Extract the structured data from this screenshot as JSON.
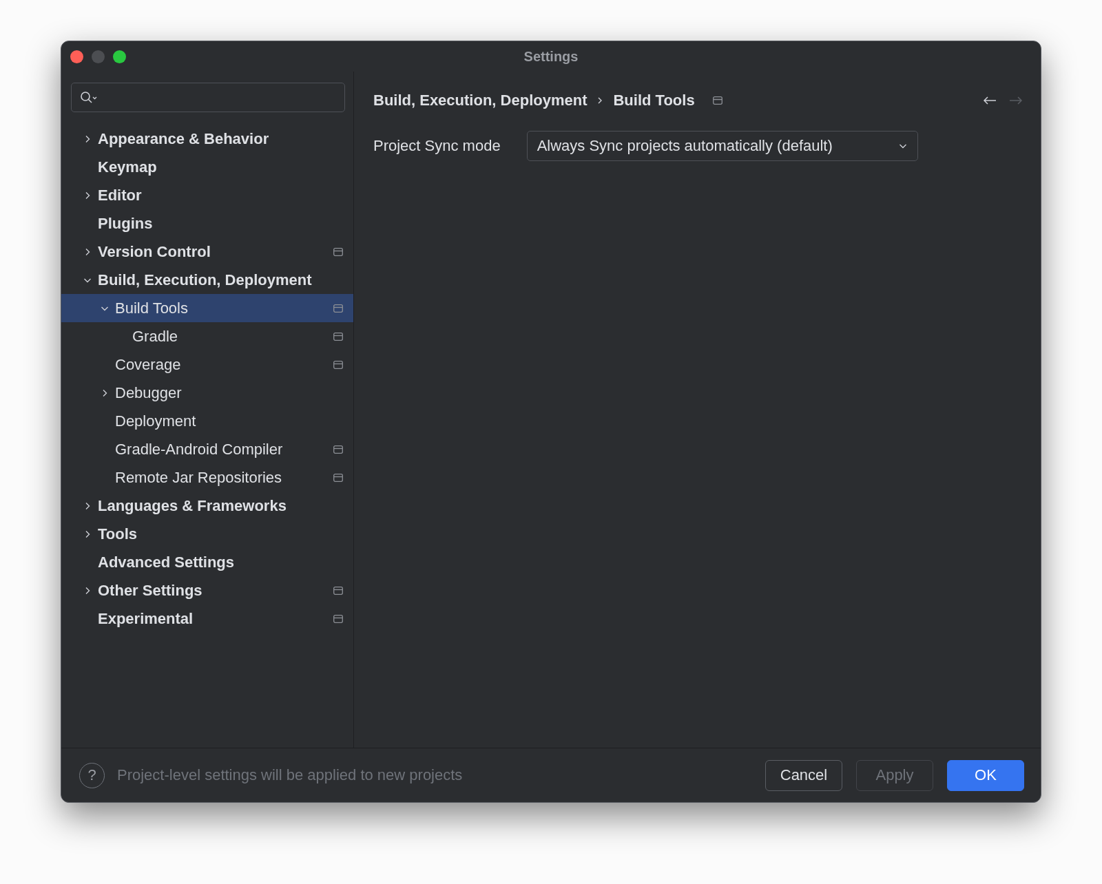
{
  "window": {
    "title": "Settings"
  },
  "sidebar": {
    "items": [
      {
        "label": "Appearance & Behavior",
        "expanded": false,
        "selected": false,
        "project_level": false
      },
      {
        "label": "Keymap",
        "selected": false,
        "project_level": false
      },
      {
        "label": "Editor",
        "expanded": false,
        "selected": false,
        "project_level": false
      },
      {
        "label": "Plugins",
        "selected": false,
        "project_level": false
      },
      {
        "label": "Version Control",
        "expanded": false,
        "selected": false,
        "project_level": true
      },
      {
        "label": "Build, Execution, Deployment",
        "expanded": true,
        "selected": false,
        "project_level": false,
        "children": [
          {
            "label": "Build Tools",
            "expanded": true,
            "selected": true,
            "project_level": true,
            "children": [
              {
                "label": "Gradle",
                "selected": false,
                "project_level": true
              }
            ]
          },
          {
            "label": "Coverage",
            "selected": false,
            "project_level": true
          },
          {
            "label": "Debugger",
            "expanded": false,
            "selected": false,
            "project_level": false
          },
          {
            "label": "Deployment",
            "selected": false,
            "project_level": false
          },
          {
            "label": "Gradle-Android Compiler",
            "selected": false,
            "project_level": true
          },
          {
            "label": "Remote Jar Repositories",
            "selected": false,
            "project_level": true
          }
        ]
      },
      {
        "label": "Languages & Frameworks",
        "expanded": false,
        "selected": false,
        "project_level": false
      },
      {
        "label": "Tools",
        "expanded": false,
        "selected": false,
        "project_level": false
      },
      {
        "label": "Advanced Settings",
        "selected": false,
        "project_level": false
      },
      {
        "label": "Other Settings",
        "expanded": false,
        "selected": false,
        "project_level": true
      },
      {
        "label": "Experimental",
        "selected": false,
        "project_level": true
      }
    ]
  },
  "content": {
    "breadcrumb": [
      "Build, Execution, Deployment",
      "Build Tools"
    ],
    "project_level": true,
    "nav": {
      "back_disabled": false,
      "forward_disabled": true
    },
    "field": {
      "label": "Project Sync mode",
      "value": "Always Sync projects automatically (default)"
    }
  },
  "footer": {
    "help": "?",
    "hint": "Project-level settings will be applied to new projects",
    "buttons": [
      {
        "label": "Cancel",
        "disabled": false,
        "default": false
      },
      {
        "label": "Apply",
        "disabled": true,
        "default": false
      },
      {
        "label": "OK",
        "disabled": false,
        "default": true
      }
    ]
  }
}
